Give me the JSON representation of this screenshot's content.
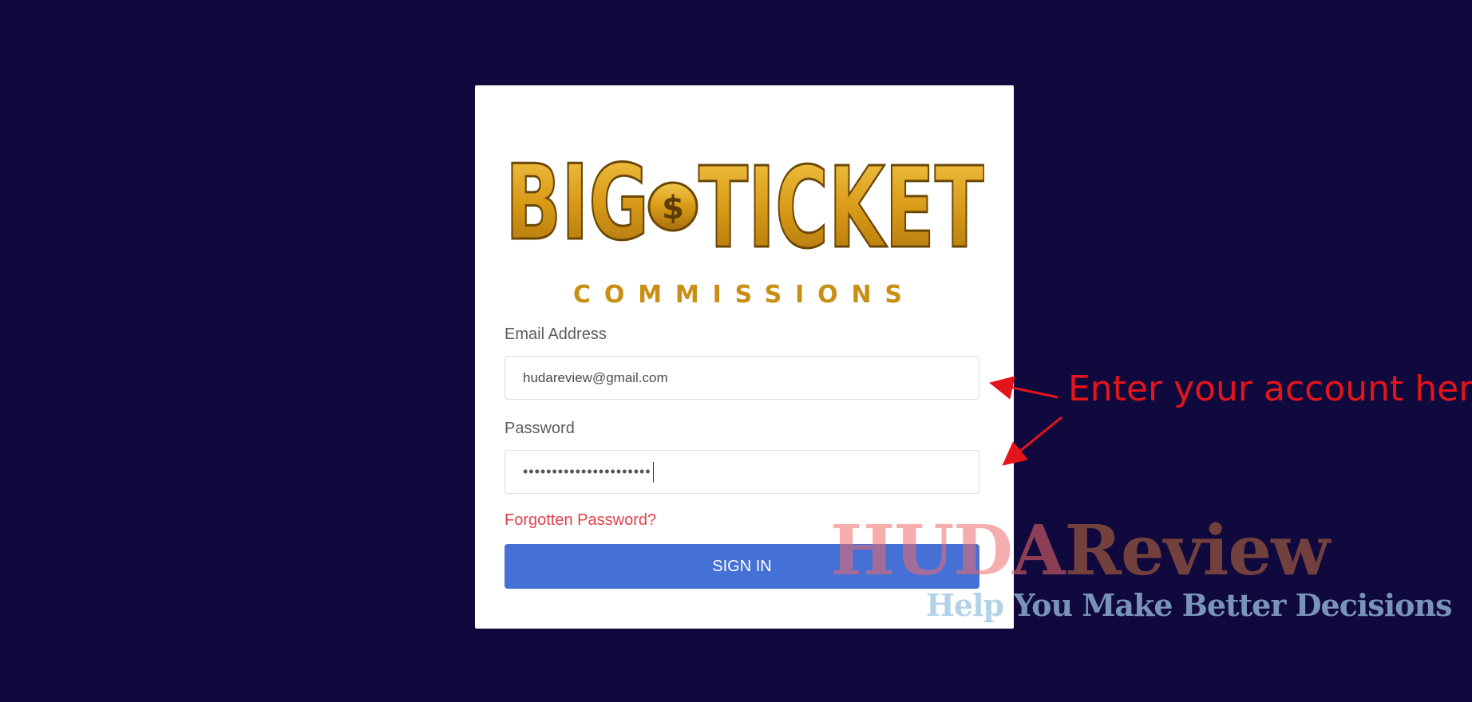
{
  "logo": {
    "line1_left": "BIG",
    "line1_coin": "$",
    "line1_right": "TICKET",
    "line2": "COMMISSIONS",
    "colors": {
      "gold": "#d9a21b",
      "dark_gold": "#7a5406"
    }
  },
  "form": {
    "email_label": "Email Address",
    "email_value": "hudareview@gmail.com",
    "password_label": "Password",
    "password_value": "••••••••••••••••••••••",
    "forgot_link": "Forgotten Password?",
    "signin_button": "SIGN IN"
  },
  "annotation": {
    "text": "Enter your account here.",
    "color": "#e3151b"
  },
  "watermark": {
    "title_a": "HUDA",
    "title_b": "Review",
    "subtitle": "Help You Make Better Decisions"
  },
  "colors": {
    "background": "#10093d",
    "button": "#4570d6",
    "link": "#e0424a"
  }
}
